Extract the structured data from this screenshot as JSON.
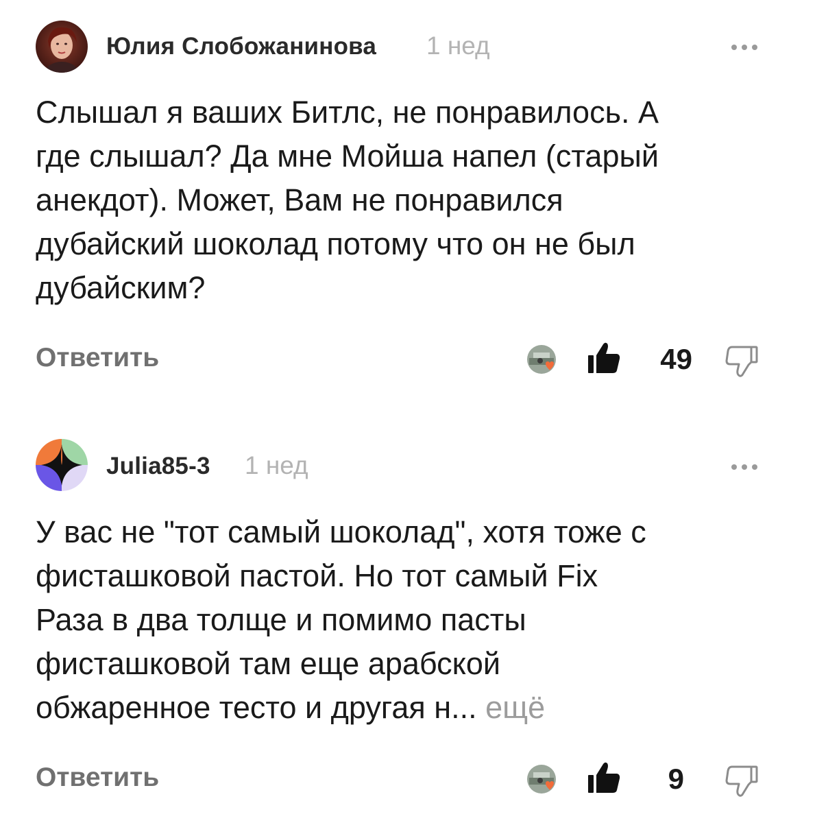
{
  "comments": [
    {
      "author": "Юлия Слобожанинова",
      "time": "1 нед",
      "text": "Слышал я ваших Битлс, не понравилось. А\nгде слышал? Да мне Мойша напел (старый\nанекдот). Может, Вам не понравился\nдубайский шоколад потому что он не был\nдубайским?",
      "more_label": "",
      "reply_label": "Ответить",
      "likes": "49",
      "avatar_icon": "user-photo-avatar",
      "reactor_icon": "reactor-avatar-with-heart"
    },
    {
      "author": "Julia85-3",
      "time": "1 нед",
      "text": "У вас не \"тот самый шоколад\", хотя тоже с\nфисташковой пастой. Но тот самый Fix\nРаза в два толще и помимо пасты\nфисташковой там еще арабской\nобжаренное тесто и другая н... ",
      "more_label": "ещё",
      "reply_label": "Ответить",
      "likes": "9",
      "avatar_icon": "generated-geometric-avatar",
      "reactor_icon": "reactor-avatar-with-heart"
    }
  ],
  "colors": {
    "heart": "#f26b3a",
    "like_icon": "#111111",
    "muted_text": "#b3b3b3",
    "reply_text": "#707070",
    "more_link": "#9c9c9c"
  }
}
